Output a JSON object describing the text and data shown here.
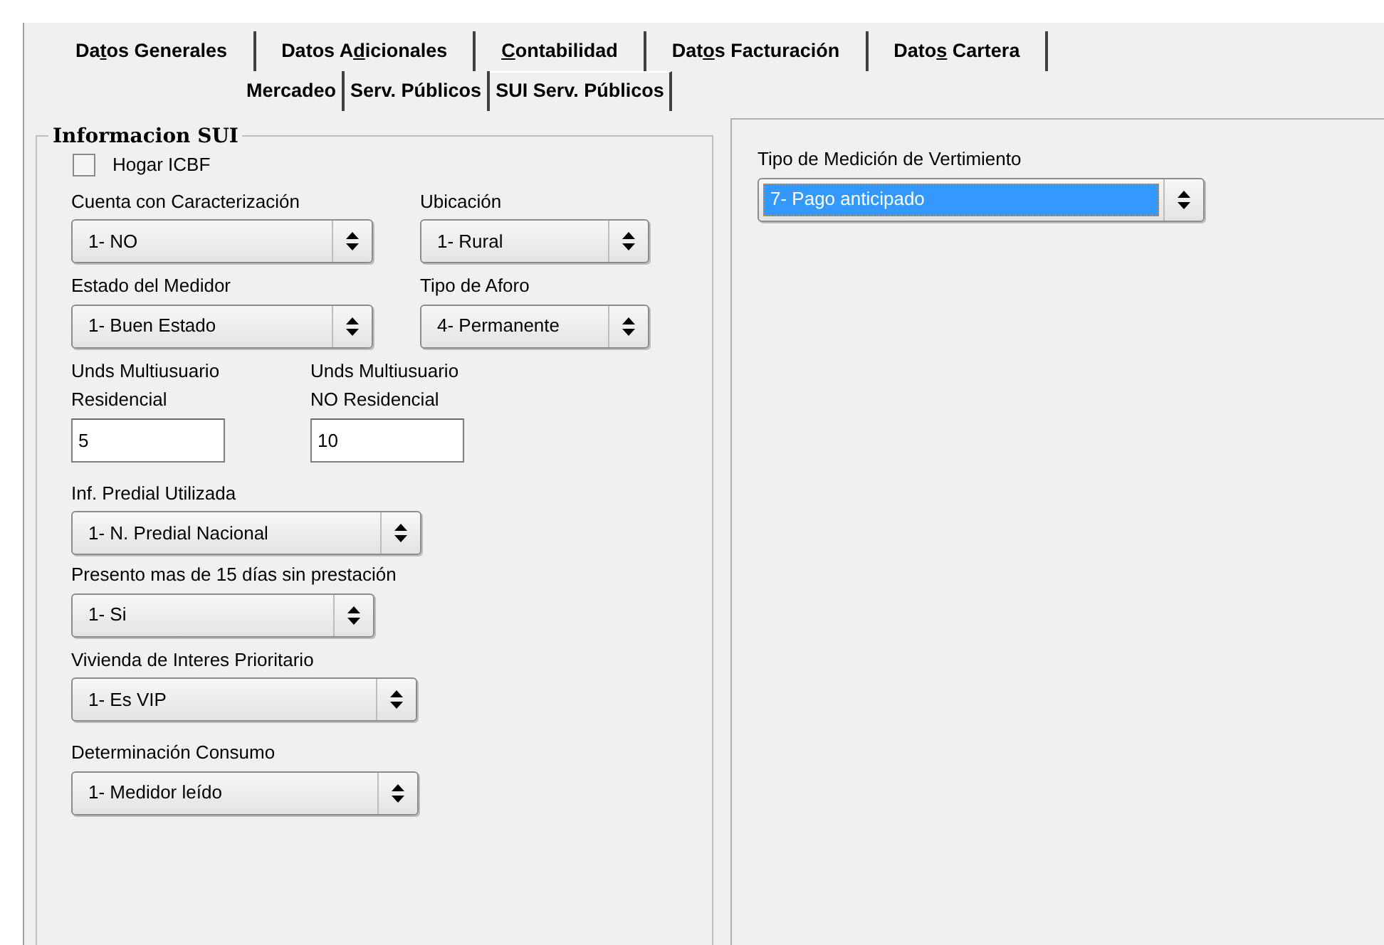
{
  "tab_rows": [
    [
      {
        "label": {
          "before": "Da",
          "key": "t",
          "after": "os Generales"
        },
        "selected": false
      },
      {
        "label": {
          "before": "Datos A",
          "key": "d",
          "after": "icionales"
        },
        "selected": false
      },
      {
        "label": {
          "key": "C",
          "after": "ontabilidad"
        },
        "selected": false
      },
      {
        "label": {
          "before": "Dat",
          "key": "o",
          "after": "s Facturación"
        },
        "selected": false
      },
      {
        "label": {
          "before": "Dato",
          "key": "s",
          "after": " Cartera"
        },
        "selected": false
      }
    ],
    [
      {
        "label": {
          "before": "Mercadeo"
        },
        "selected": false
      },
      {
        "label": {
          "before": "Serv. Públicos"
        },
        "selected": false
      },
      {
        "label": {
          "before": "SUI Serv. Públicos"
        },
        "selected": true
      }
    ]
  ],
  "group": {
    "title": "Informacion SUI",
    "checkbox": {
      "label": "Hogar ICBF",
      "checked": false
    },
    "rows": [
      [
        {
          "kind": "combo",
          "label": "Cuenta con Caracterización",
          "value": "1- NO",
          "focused": false
        },
        {
          "kind": "combo",
          "label": "Ubicación",
          "value": "1- Rural",
          "focused": false
        }
      ],
      [
        {
          "kind": "combo",
          "label": "Estado del Medidor",
          "value": "1- Buen Estado",
          "focused": false
        },
        {
          "kind": "combo",
          "label": "Tipo de Aforo",
          "value": "4- Permanente",
          "focused": false
        }
      ],
      [
        {
          "kind": "text",
          "label": "Unds Multiusuario\nResidencial",
          "value": "5"
        },
        {
          "kind": "text",
          "label": "Unds Multiusuario\nNO Residencial",
          "value": "10"
        }
      ],
      [
        {
          "kind": "combo",
          "label": "Inf. Predial Utilizada",
          "value": "1- N. Predial Nacional",
          "focused": false
        }
      ],
      [
        {
          "kind": "combo",
          "label": "Presento mas de 15 días sin prestación",
          "value": "1- Si",
          "focused": false
        }
      ],
      [
        {
          "kind": "combo",
          "label": "Vivienda de Interes Prioritario",
          "value": "1- Es VIP",
          "focused": false
        }
      ],
      [
        {
          "kind": "combo",
          "label": "Determinación Consumo",
          "value": "1- Medidor leído",
          "focused": false
        }
      ]
    ]
  },
  "right_panel": {
    "fields": [
      {
        "kind": "combo",
        "label": "Tipo de Medición de Vertimiento",
        "value": "7- Pago anticipado",
        "focused": true
      }
    ]
  }
}
